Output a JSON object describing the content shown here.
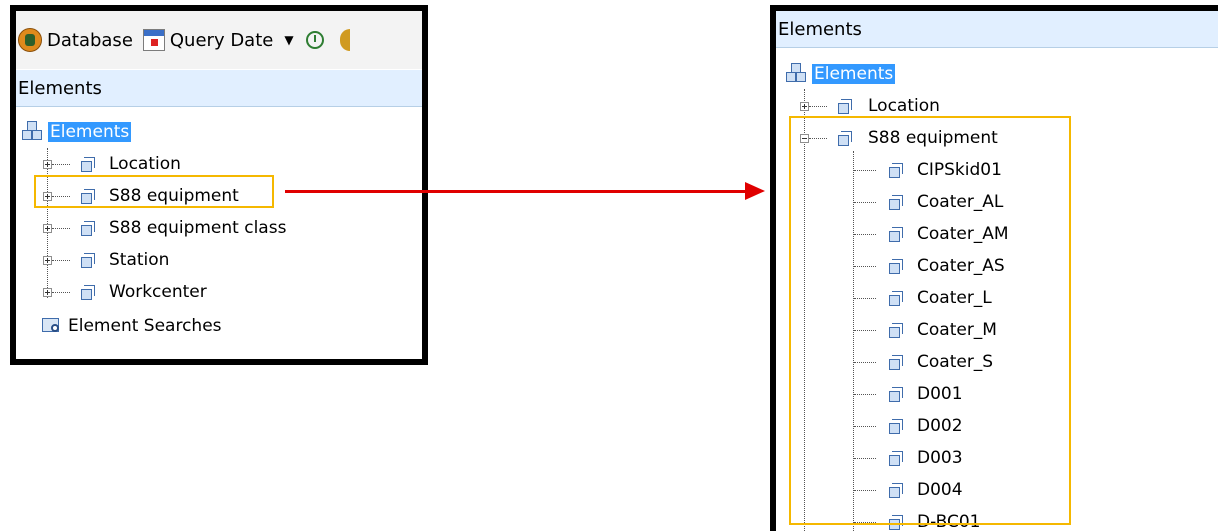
{
  "toolbar": {
    "database_label": "Database",
    "query_date_label": "Query Date"
  },
  "left_panel": {
    "header": "Elements",
    "root_label": "Elements",
    "items": [
      {
        "label": "Location"
      },
      {
        "label": "S88 equipment"
      },
      {
        "label": "S88 equipment class"
      },
      {
        "label": "Station"
      },
      {
        "label": "Workcenter"
      }
    ],
    "searches_label": "Element Searches"
  },
  "right_panel": {
    "header": "Elements",
    "root_label": "Elements",
    "location_label": "Location",
    "expanded_label": "S88 equipment",
    "children": [
      "CIPSkid01",
      "Coater_AL",
      "Coater_AM",
      "Coater_AS",
      "Coater_L",
      "Coater_M",
      "Coater_S",
      "D001",
      "D002",
      "D003",
      "D004",
      "D-BC01"
    ]
  },
  "colors": {
    "highlight": "#f5b800",
    "arrow": "#e00000",
    "selection": "#3399ff",
    "header_bg": "#e1efff"
  }
}
